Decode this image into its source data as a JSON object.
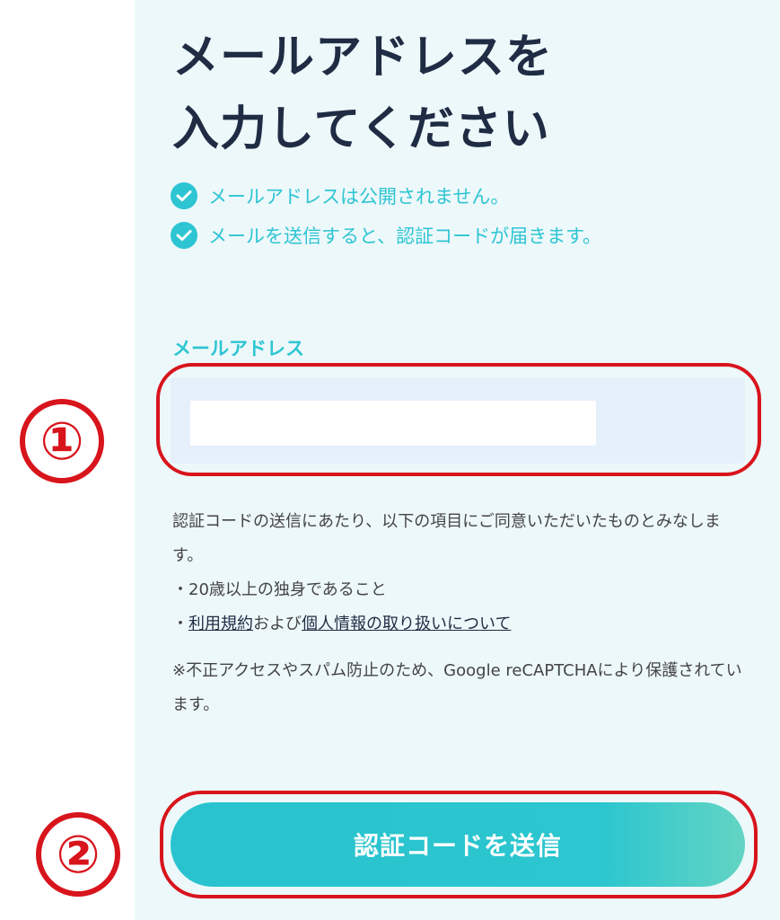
{
  "title": {
    "line1": "メールアドレスを",
    "line2": "入力してください"
  },
  "checks": [
    "メールアドレスは公開されません。",
    "メールを送信すると、認証コードが届きます。"
  ],
  "form": {
    "email_label": "メールアドレス",
    "email_value": "",
    "email_placeholder": ""
  },
  "notice": {
    "intro": "認証コードの送信にあたり、以下の項目にご同意いただいたものとみなします。",
    "item1": "・20歳以上の独身であること",
    "item2_prefix": "・",
    "terms_link": "利用規約",
    "item2_mid": "および",
    "privacy_link": "個人情報の取り扱いについて",
    "recaptcha": "※不正アクセスやスパム防止のため、Google reCAPTCHAにより保護されています。"
  },
  "submit_label": "認証コードを送信",
  "annotations": {
    "step1": "①",
    "step2": "②"
  },
  "colors": {
    "accent": "#2ec5d3",
    "title": "#1f2c44",
    "annotation": "#d8141c"
  }
}
